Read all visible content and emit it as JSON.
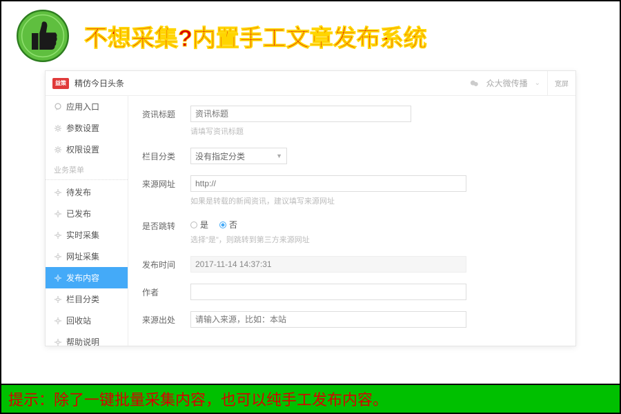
{
  "banner": {
    "title": "不想采集?内置手工文章发布系统"
  },
  "header": {
    "app_title": "精仿今日头条",
    "broadcast": "众大微传播",
    "wide_btn": "宽屏"
  },
  "sidebar": {
    "top": [
      {
        "label": "应用入口",
        "icon": "bubble"
      },
      {
        "label": "参数设置",
        "icon": "gear"
      },
      {
        "label": "权限设置",
        "icon": "gear"
      }
    ],
    "section": "业务菜单",
    "biz": [
      {
        "label": "待发布"
      },
      {
        "label": "已发布"
      },
      {
        "label": "实时采集"
      },
      {
        "label": "网址采集"
      },
      {
        "label": "发布内容",
        "active": true
      },
      {
        "label": "栏目分类"
      },
      {
        "label": "回收站"
      },
      {
        "label": "帮助说明"
      }
    ]
  },
  "form": {
    "title": {
      "label": "资讯标题",
      "placeholder": "资讯标题",
      "hint": "请填写资讯标题"
    },
    "category": {
      "label": "栏目分类",
      "value": "没有指定分类"
    },
    "source_url": {
      "label": "来源网址",
      "placeholder": "http://",
      "hint": "如果是转载的新闻资讯，建议填写来源网址"
    },
    "redirect": {
      "label": "是否跳转",
      "yes": "是",
      "no": "否",
      "hint": "选择\"是\"，则跳转到第三方来源网址"
    },
    "publish_time": {
      "label": "发布时间",
      "value": "2017-11-14 14:37:31"
    },
    "author": {
      "label": "作者"
    },
    "source": {
      "label": "来源出处",
      "placeholder": "请输入来源，比如：本站"
    }
  },
  "footer": {
    "tip": "提示：除了一键批量采集内容，也可以纯手工发布内容。"
  }
}
